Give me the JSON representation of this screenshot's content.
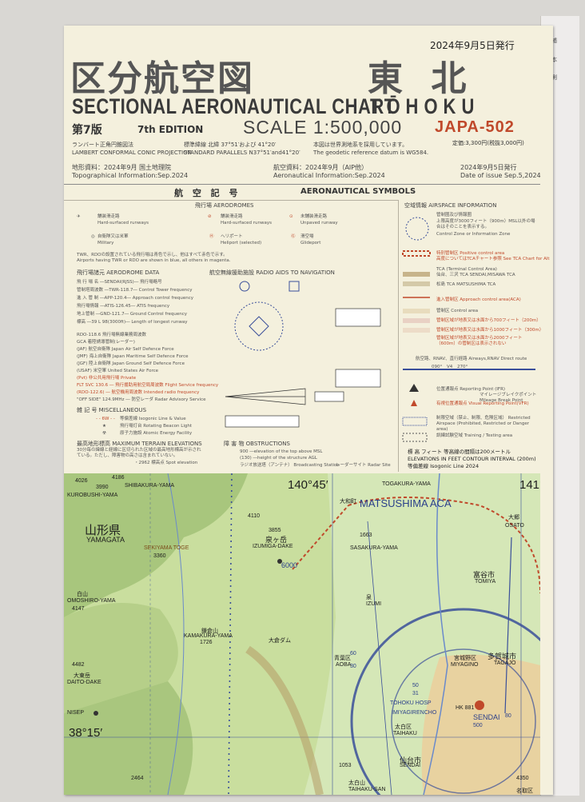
{
  "cover_edge": {
    "lines": [
      "・補",
      "C",
      "・本",
      "・測",
      "R"
    ]
  },
  "header": {
    "issue_top": "2024年9月5日発行",
    "title_jp_left": "区分航空図",
    "title_jp_right": "東 北",
    "title_en_left": "SECTIONAL AERONAUTICAL CHART",
    "title_en_right": "TŌHOKU",
    "edition_jp": "第7版",
    "edition_en": "7th EDITION",
    "scale": "SCALE 1:500,000",
    "chart_no": "JAPA-502",
    "price": "定価:3,300円(税抜3,000円)",
    "projection_jp": "ランバート正角円錐図法",
    "projection_en": "LAMBERT CONFORMAL CONIC PROJECTION",
    "parallels_jp": "標準緯線  北緯 37°51′および 41°20′",
    "parallels_en": "STANDARD PARALLELS  N37°51′and41°20′",
    "datum_jp": "本図は世界測地系を採用しています。",
    "datum_en": "The geodetic reference datum is WG584.",
    "topo_jp": "地形資料：2024年9月 国土地理院",
    "topo_en": "Topographical Information:Sep.2024",
    "aero_jp": "航空資料：2024年9月（AIP他）",
    "aero_en": "Aeronautical Information:Sep.2024",
    "issue_jp": "2024年9月5日発行",
    "issue_en": "Date of issue Sep.5,2024"
  },
  "legend": {
    "heading_jp": "航 空 記 号",
    "heading_en": "AERONAUTICAL SYMBOLS",
    "aerodromes": "飛行場  AERODROMES",
    "airspace": "空域情報 AIRSPACE  INFORMATION",
    "aerodromes_items": [
      "舗装滑走路",
      "Hard-surfaced runways",
      "舗装滑走路",
      "Hard-surfaced runways",
      "未舗装滑走路",
      "Unpaved runway",
      "自衛隊又は米軍",
      "Military",
      "ヘリポート",
      "Heliport (selected)",
      "滑空場",
      "Glideport"
    ],
    "twr_note": "TWR、RDOの設置されている飛行場は青色で示し、他はすべて赤色で示す。",
    "twr_note_en": "Airports having TWR or RDO are shown in blue, all others in magenta.",
    "aerodrome_data": "飛行場諸元  AERODROME DATA",
    "radio_aids": "航空無線援助施設  RADIO AIDS TO NAVIGATION",
    "data_rows": [
      "飛 行 場 名 ―SENDAI(RJSS)― 飛行場略号",
      "管制塔周波数 ―TWR-118.7― Control Tower frequency",
      "進 入 管 制 ―APP-120.4― Approach control frequency",
      "飛行場情報 ―ATIS-126.45― ATIS frequency",
      "地上管制 ―GND-121.7― Ground Control frequency",
      "標高 ―39 L 98(3000ft)― Length of longest runway"
    ],
    "agency_rows": [
      "RDO-118.6  飛行場無線業務周波数",
      "GCA  着陸誘導管制(レーダー)",
      "(JAF)  航空自衛隊  Japan Air Self Defence Force",
      "(JMF)  海上自衛隊  Japan Maritime Self Defence Force",
      "(JGF)  陸上自衛隊  Japan Ground Self Defence Force",
      "(USAF)  米空軍  United States Air Force",
      "(Pvt)  非公共用飛行場  Private",
      "FLT SVC 130.6 ― 飛行援助用航空局周波数  Flight Service frequency",
      "(RDO-122.6) ― 航空機用周波数  Intended radio frequency",
      "\"OFF SIDE\" 124.9MHz ― 防空レーダ  Radar Advisory Service"
    ],
    "misc": "雑 記 号  MISCELLANEOUS",
    "misc_rows": [
      "等偏差線  Isogonic Line & Value",
      "飛行場灯台  Rotating Beacon Light",
      "原子力施設  Atomic Energy Facility"
    ],
    "max_terrain": "最高地形標高  MAXIMUM TERRAIN ELEVATIONS",
    "max_terrain_note": "30分毎の緯線と経線に区切られた区域の最高地形標高が示されている。ただし、障害物の高さは含まれていない。",
    "spot_elev": "・2962 標高点  Spot elevation",
    "obstructions": "障 害 物  OBSTRUCTIONS",
    "obst_rows": [
      "900 ―elevation of the top above MSL",
      "(130) ―height of the structure AGL",
      "ラジオ放送塔（アンテナ） Broadcasting Station",
      "レーダーサイト Radar Site"
    ],
    "airspace_rows": [
      "管制圏及び情報圏",
      "上限高度が3000フィート（900m）MSL以外の場合はそのことを表示する。",
      "Control Zone or Information Zone",
      "特別管制区  Positive control area",
      "高度についてはTCAチャート参照 See TCA Chart for Alt",
      "TCA (Terminal Control Area)",
      "仙台、三沢 TCA  SENDAI,MISAWA TCA",
      "松島 TCA  MATSUSHIMA TCA",
      "進入管制区  Approach control area(ACA)",
      "管制区  Control area",
      "管制区域が地表又は水面から700フィート（200m）",
      "管制区域が地表又は水面から1000フィート（300m）",
      "管制区域が地表又は水面から2000フィート（600m）の管制区は表示されない",
      "航空路、RNAV、直行経路  Airways,RNAV Direct route",
      "位置通報点  Reporting Point (IFR)",
      "有視位置通報点  Visual Reporting Point(VFR)",
      "マイレージブレイクポイント  Mileage Break Point",
      "制限空域（禁止、制限、危険区域）  Restricted Airspace (Prohibited, Restricted or Danger area)",
      "訓練試験空域  Training / Testing area",
      "標  高  フィート  等高線の間隔は200メートル",
      "ELEVATIONS IN FEET  CONTOUR INTERVAL (200m)",
      "等偏差線  Isogonic Line 2024"
    ],
    "airway_sample": [
      "090°",
      "V4",
      "270°"
    ]
  },
  "map": {
    "labels": [
      "4026",
      "4186",
      "SHIBAKURA-YAMA",
      "3990",
      "KUROBUSHI-YAMA",
      "4110",
      "140°45′",
      "TOGAKURA-YAMA",
      "141°",
      "大和町",
      "MATSUSHIMA ACA",
      "山形県",
      "YAMAGATA",
      "3855",
      "泉ヶ岳",
      "IZUMIGA-DAKE",
      "SEKIYAMA TOGE",
      "3360",
      "1663",
      "SASAKURA-YAMA",
      "6000",
      "大郷",
      "OSATO",
      "富谷市",
      "TOMIYA",
      "白山",
      "OMOSHIRO-YAMA",
      "4147",
      "泉",
      "IZUMI",
      "鎌倉山",
      "KAMAKURA-YAMA",
      "1726",
      "大倉ダム",
      "青葉区",
      "AOBA",
      "宮城野区",
      "MIYAGINO",
      "多賀城市",
      "TAGAJO",
      "4482",
      "大東岳",
      "DAITO-DAKE",
      "NISEP",
      "TOHOKU HOSP",
      "IMIYAGIRENCHO",
      "HK 881",
      "SENDAI",
      "38°15′",
      "太白区",
      "TAIHAKU",
      "仙台市",
      "SENDAI",
      "太白山",
      "TAIHAKU-SAN",
      "4350",
      "2464",
      "名取区",
      "60",
      "30",
      "1053",
      "50",
      "31",
      "500",
      "80"
    ]
  }
}
